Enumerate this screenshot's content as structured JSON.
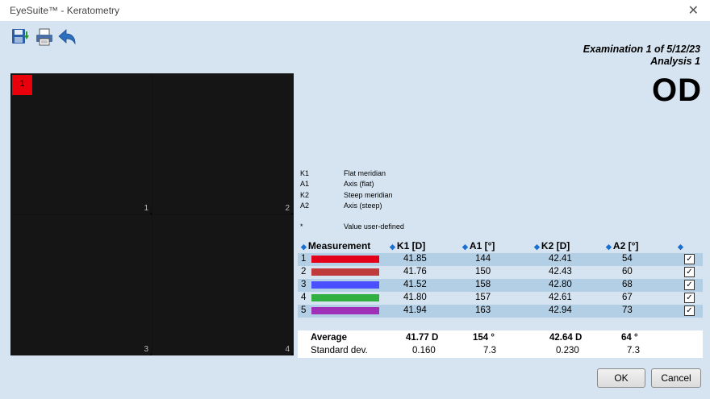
{
  "window": {
    "title": "EyeSuite™ - Keratometry",
    "close_icon": "close-icon"
  },
  "toolbar": {
    "icons": [
      "save-icon",
      "print-icon",
      "back-icon"
    ]
  },
  "exam": {
    "line1": "Examination 1 of 5/12/23",
    "line2": "Analysis 1",
    "eye": "OD"
  },
  "images": {
    "badge": "1",
    "labels": [
      "1",
      "2",
      "3",
      "4"
    ]
  },
  "legend": [
    {
      "key": "K1",
      "value": "Flat meridian"
    },
    {
      "key": "A1",
      "value": "Axis (flat)"
    },
    {
      "key": "K2",
      "value": "Steep meridian"
    },
    {
      "key": "A2",
      "value": "Axis (steep)"
    },
    {
      "key": "",
      "value": ""
    },
    {
      "key": "*",
      "value": "Value user-defined"
    }
  ],
  "table": {
    "headers": [
      "Measurement",
      "K1 [D]",
      "A1 [°]",
      "K2 [D]",
      "A2 [°]"
    ],
    "rows": [
      {
        "n": "1",
        "color": "#e3001b",
        "k1": "41.85",
        "a1": "144",
        "k2": "42.41",
        "a2": "54",
        "checked": "✓"
      },
      {
        "n": "2",
        "color": "#c0393b",
        "k1": "41.76",
        "a1": "150",
        "k2": "42.43",
        "a2": "60",
        "checked": "✓"
      },
      {
        "n": "3",
        "color": "#4a4fff",
        "k1": "41.52",
        "a1": "158",
        "k2": "42.80",
        "a2": "68",
        "checked": "✓"
      },
      {
        "n": "4",
        "color": "#2fb040",
        "k1": "41.80",
        "a1": "157",
        "k2": "42.61",
        "a2": "67",
        "checked": "✓"
      },
      {
        "n": "5",
        "color": "#a030b8",
        "k1": "41.94",
        "a1": "163",
        "k2": "42.94",
        "a2": "73",
        "checked": "✓"
      }
    ]
  },
  "summary": {
    "avg_label": "Average",
    "avg_k1": "41.77 D",
    "avg_a1": "154 °",
    "avg_k2": "42.64 D",
    "avg_a2": "64 °",
    "sd_label": "Standard dev.",
    "sd_k1": "0.160",
    "sd_a1": "7.3",
    "sd_k2": "0.230",
    "sd_a2": "7.3"
  },
  "buttons": {
    "ok": "OK",
    "cancel": "Cancel"
  }
}
